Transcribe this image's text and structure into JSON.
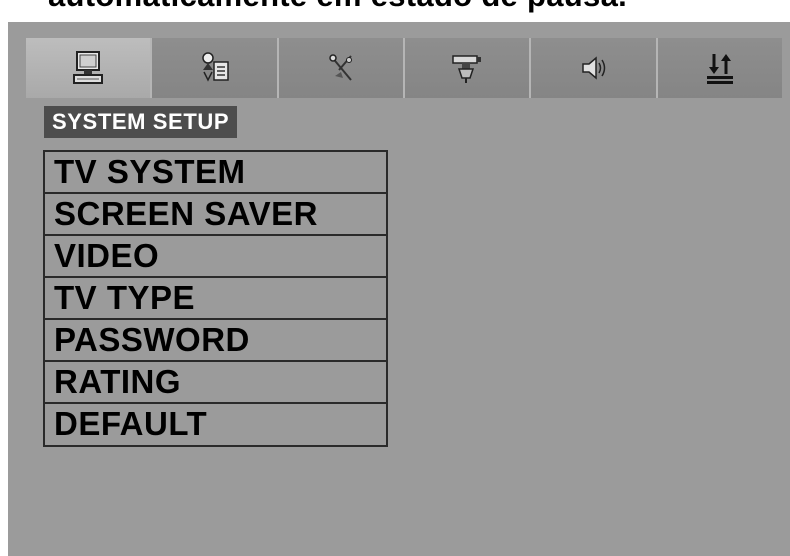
{
  "caption": {
    "text": "automaticamente em estado de pausa."
  },
  "tabs": [
    {
      "icon": "monitor-icon",
      "active": true
    },
    {
      "icon": "language-icon",
      "active": false
    },
    {
      "icon": "video-settings-icon",
      "active": false
    },
    {
      "icon": "speaker-setup-icon",
      "active": false
    },
    {
      "icon": "audio-icon",
      "active": false
    },
    {
      "icon": "up-down-arrows-icon",
      "active": false
    }
  ],
  "section": {
    "title": "SYSTEM SETUP"
  },
  "menu": {
    "items": [
      {
        "label": "TV SYSTEM"
      },
      {
        "label": "SCREEN SAVER"
      },
      {
        "label": "VIDEO"
      },
      {
        "label": "TV TYPE"
      },
      {
        "label": "PASSWORD"
      },
      {
        "label": "RATING"
      },
      {
        "label": "DEFAULT"
      }
    ]
  },
  "colors": {
    "screen_bg": "#9b9b9b",
    "header_bg": "#4d4d4d",
    "header_text": "#ffffff",
    "menu_text": "#000000"
  }
}
